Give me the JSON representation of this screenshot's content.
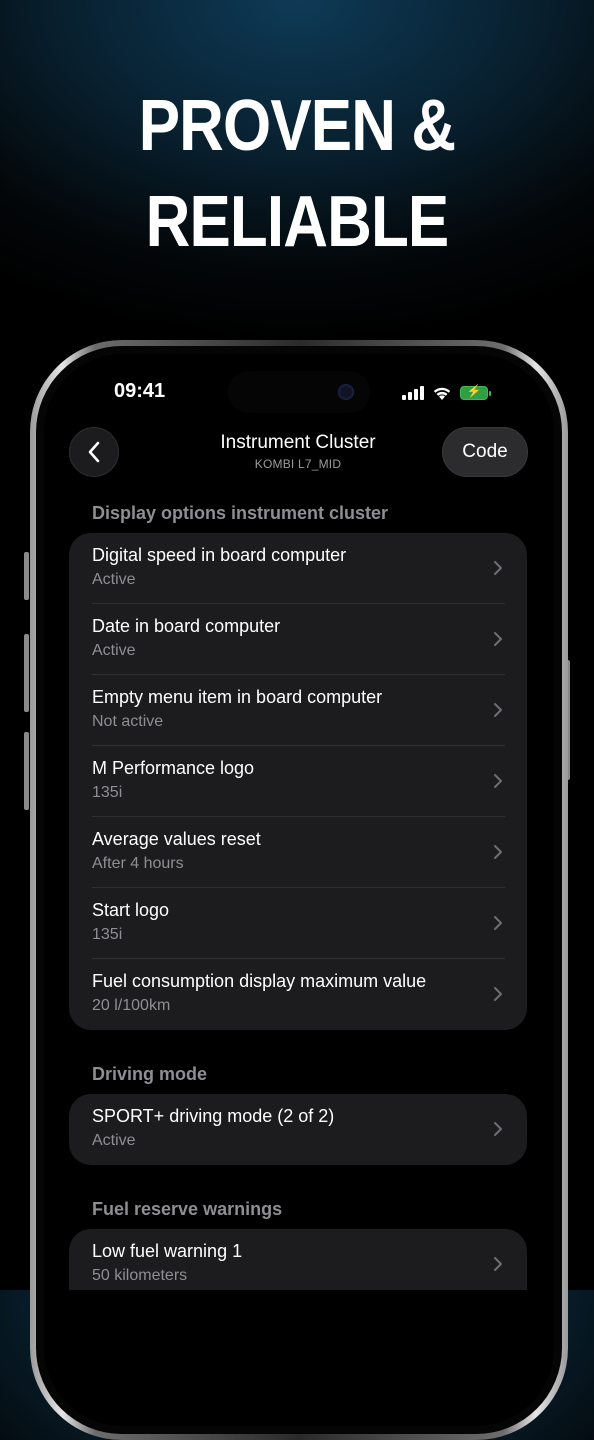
{
  "headline": {
    "line1": "PROVEN &",
    "line2": "RELIABLE"
  },
  "status_bar": {
    "time": "09:41"
  },
  "nav": {
    "title": "Instrument Cluster",
    "subtitle": "KOMBI L7_MID",
    "code_label": "Code",
    "back_icon": "chevron-left-icon"
  },
  "sections": [
    {
      "header": "Display options instrument cluster",
      "rows": [
        {
          "title": "Digital speed in board computer",
          "value": "Active"
        },
        {
          "title": "Date in board computer",
          "value": "Active"
        },
        {
          "title": "Empty menu item in board computer",
          "value": "Not active"
        },
        {
          "title": "M Performance logo",
          "value": "135i"
        },
        {
          "title": "Average values reset",
          "value": "After 4 hours"
        },
        {
          "title": "Start logo",
          "value": "135i"
        },
        {
          "title": "Fuel consumption display maximum value",
          "value": "20 l/100km"
        }
      ]
    },
    {
      "header": "Driving mode",
      "rows": [
        {
          "title": "SPORT+ driving mode (2 of 2)",
          "value": "Active"
        }
      ]
    },
    {
      "header": "Fuel reserve warnings",
      "rows": [
        {
          "title": "Low fuel warning 1",
          "value": "50 kilometers"
        }
      ]
    }
  ],
  "colors": {
    "accent_battery": "#2ea043",
    "card": "#1c1c1e",
    "secondary_text": "#8e8e93"
  }
}
